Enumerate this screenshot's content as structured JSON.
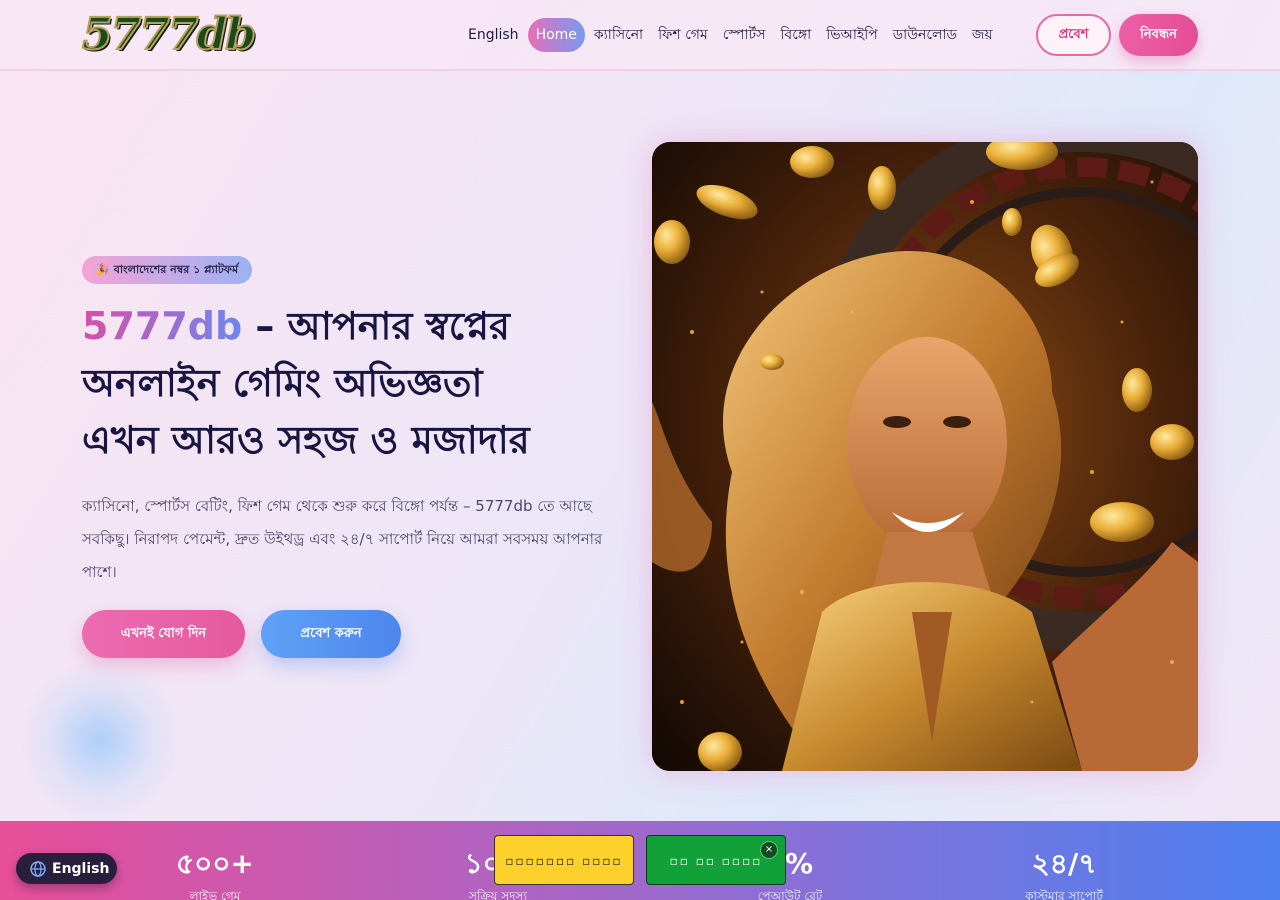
{
  "header": {
    "logo_text": "5777db",
    "nav": [
      {
        "label": "English"
      },
      {
        "label": "Home",
        "active": true
      },
      {
        "label": "ক্যাসিনো"
      },
      {
        "label": "ফিশ গেম"
      },
      {
        "label": "স্পোর্টস"
      },
      {
        "label": "বিঙ্গো"
      },
      {
        "label": "ভিআইপি"
      },
      {
        "label": "ডাউনলোড"
      },
      {
        "label": "জয়"
      }
    ],
    "login_label": "প্রবেশ",
    "register_label": "নিবন্ধন"
  },
  "hero": {
    "badge_emoji": "🎉",
    "badge_text": "বাংলাদেশের নম্বর ১ প্ল্যাটফর্ম",
    "title_brand": "5777db",
    "title_line1_rest": " – আপনার স্বপ্নের",
    "title_line2": "অনলাইন গেমিং অভিজ্ঞতা",
    "title_line3": "এখন আরও সহজ ও মজাদার",
    "description": "ক্যাসিনো, স্পোর্টস বেটিং, ফিশ গেম থেকে শুরু করে বিঙ্গো পর্যন্ত – 5777db তে আছে সবকিছু। নিরাপদ পেমেন্ট, দ্রুত উইথড্র এবং ২৪/৭ সাপোর্ট নিয়ে আমরা সবসময় আপনার পাশে।",
    "join_label": "এখনই যোগ দিন",
    "enter_label": "প্রবেশ করুন"
  },
  "stats": [
    {
      "value": "৫০০+",
      "label": "লাইভ গেম"
    },
    {
      "value": "১০ ল",
      "label": "সক্রিয় সদস্য"
    },
    {
      "value": "৫%",
      "label": "পেআউট রেট"
    },
    {
      "value": "২৪/৭",
      "label": "কাস্টমার সাপোর্ট"
    }
  ],
  "floating": {
    "yellow_label": "▫▫▫▫▫▫▫ ▫▫▫▫",
    "green_label": "▫▫ ▫▫ ▫▫▫▫",
    "close_glyph": "×"
  },
  "language_switch": {
    "label": "English"
  },
  "icons": {
    "globe": "globe-icon",
    "party": "party-popper-icon",
    "close": "close-icon"
  },
  "colors": {
    "brand_pink": "#e84f99",
    "brand_blue": "#4e80f0",
    "text_dark": "#181640"
  }
}
